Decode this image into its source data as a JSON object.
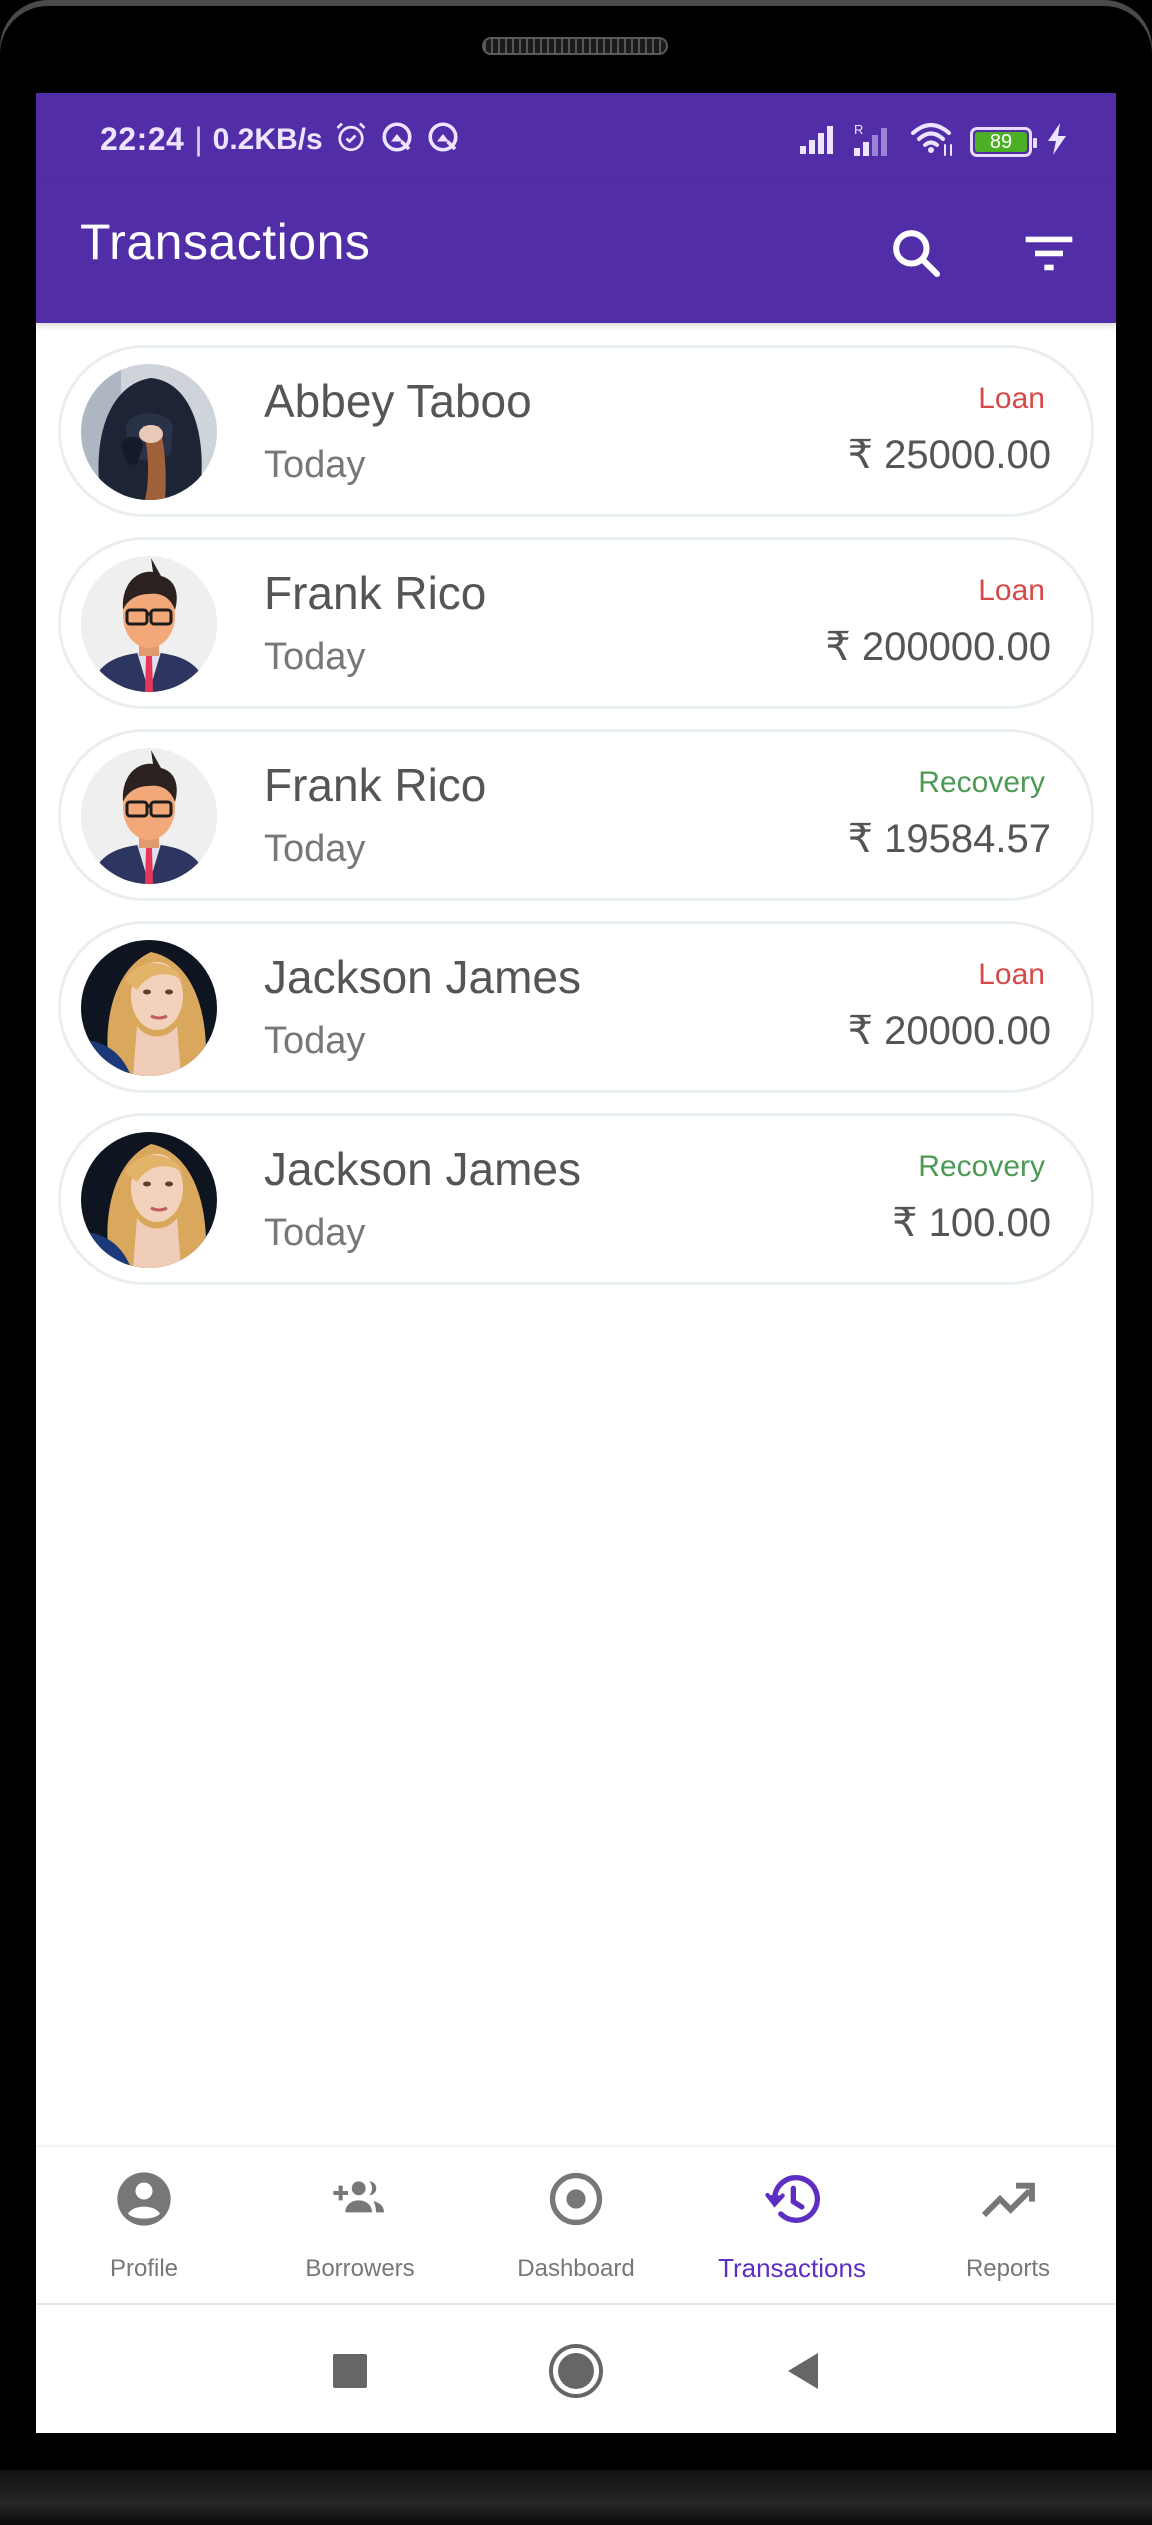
{
  "status_bar": {
    "time": "22:24",
    "separator": "|",
    "network_speed": "0.2KB/s",
    "left_icons": [
      "alarm-icon",
      "vpn-q-icon",
      "vpn-q-icon"
    ],
    "right_icons": [
      "signal-icon",
      "roaming-signal-icon",
      "wifi-icon",
      "battery-icon",
      "charging-icon"
    ],
    "roaming_label": "R",
    "battery_level": "89"
  },
  "app_bar": {
    "title": "Transactions",
    "actions": [
      {
        "icon": "search-icon",
        "label": "Search"
      },
      {
        "icon": "filter-icon",
        "label": "Filter"
      }
    ]
  },
  "transactions": [
    {
      "name": "Abbey Taboo",
      "date": "Today",
      "type": "Loan",
      "type_key": "loan",
      "amount": "₹ 25000.00",
      "avatar": "hooded-woman-photo"
    },
    {
      "name": "Frank Rico",
      "date": "Today",
      "type": "Loan",
      "type_key": "loan",
      "amount": "₹ 200000.00",
      "avatar": "man-with-glasses-illustration"
    },
    {
      "name": "Frank Rico",
      "date": "Today",
      "type": "Recovery",
      "type_key": "recovery",
      "amount": "₹ 19584.57",
      "avatar": "man-with-glasses-illustration"
    },
    {
      "name": "Jackson James",
      "date": "Today",
      "type": "Loan",
      "type_key": "loan",
      "amount": "₹ 20000.00",
      "avatar": "blonde-woman-photo"
    },
    {
      "name": "Jackson James",
      "date": "Today",
      "type": "Recovery",
      "type_key": "recovery",
      "amount": "₹ 100.00",
      "avatar": "blonde-woman-photo"
    }
  ],
  "colors": {
    "primary": "#512DA8",
    "active_tab": "#5E2EC2",
    "loan": "#D94848",
    "recovery": "#4C9A55",
    "battery": "#4CAF25"
  },
  "bottom_nav": {
    "items": [
      {
        "label": "Profile",
        "icon": "account-circle-icon",
        "active": false
      },
      {
        "label": "Borrowers",
        "icon": "group-add-icon",
        "active": false
      },
      {
        "label": "Dashboard",
        "icon": "radio-button-icon",
        "active": false
      },
      {
        "label": "Transactions",
        "icon": "history-icon",
        "active": true
      },
      {
        "label": "Reports",
        "icon": "trending-up-icon",
        "active": false
      }
    ]
  },
  "system_nav": {
    "buttons": [
      {
        "icon": "recents-square-icon",
        "label": "Recents"
      },
      {
        "icon": "home-circle-icon",
        "label": "Home"
      },
      {
        "icon": "back-triangle-icon",
        "label": "Back"
      }
    ]
  }
}
